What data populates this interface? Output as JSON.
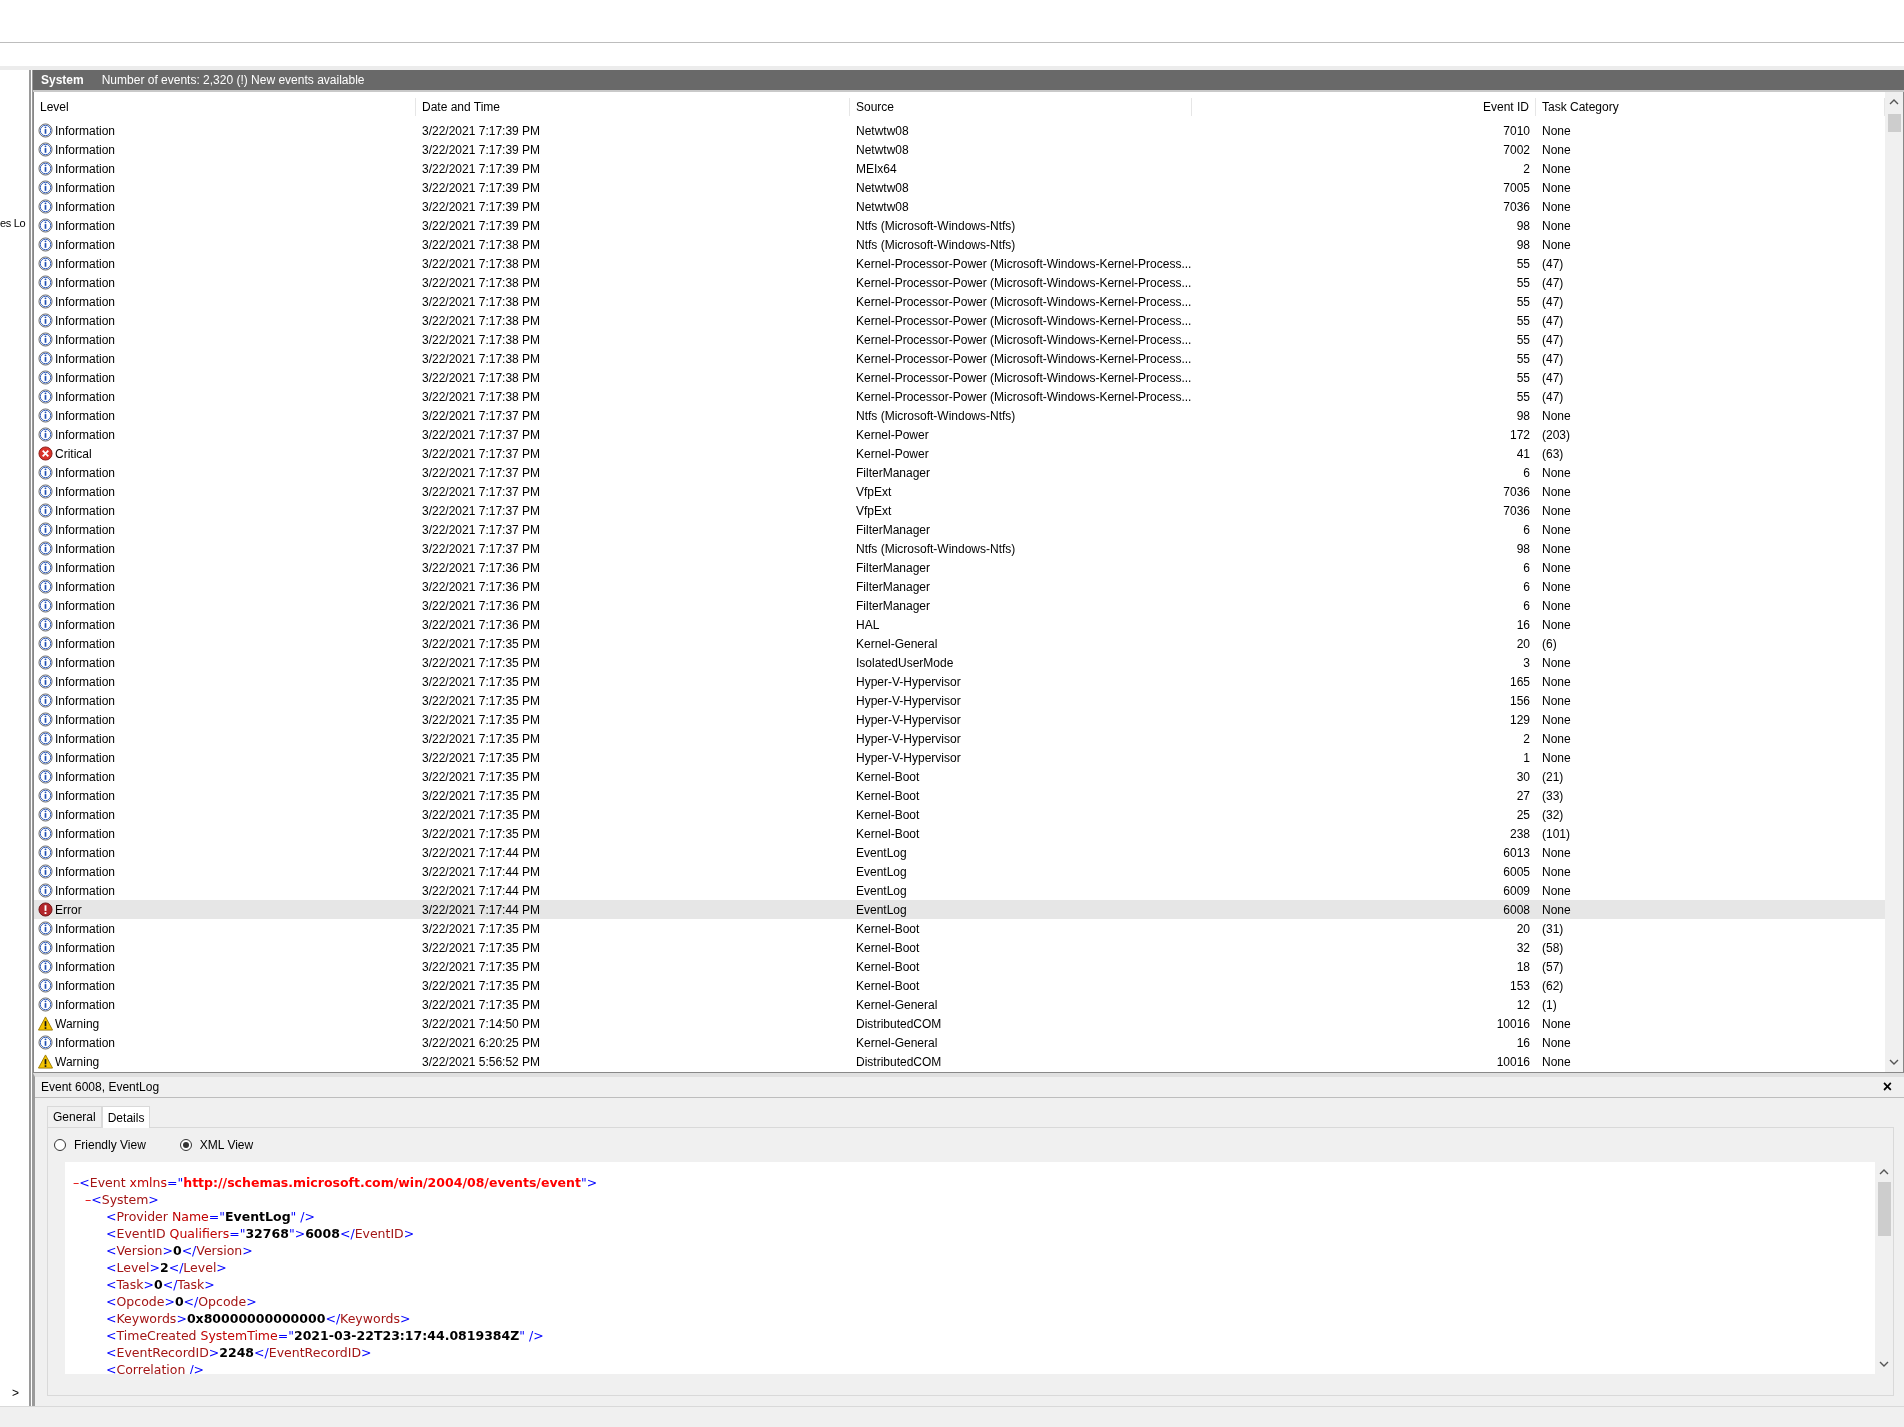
{
  "left_panel": {
    "cut_label": "es Lo",
    "expand_glyph": ">"
  },
  "log_header": {
    "title": "System",
    "summary": "Number of events: 2,320 (!) New events available"
  },
  "table": {
    "columns": [
      {
        "label": "Level"
      },
      {
        "label": "Date and Time"
      },
      {
        "label": "Source"
      },
      {
        "label": "Event ID"
      },
      {
        "label": "Task Category"
      }
    ],
    "rows": [
      {
        "kind": "information",
        "level": "Information",
        "date": "3/22/2021 7:17:39 PM",
        "source": "Netwtw08",
        "event_id": "7010",
        "task_category": "None",
        "selected": false
      },
      {
        "kind": "information",
        "level": "Information",
        "date": "3/22/2021 7:17:39 PM",
        "source": "Netwtw08",
        "event_id": "7002",
        "task_category": "None",
        "selected": false
      },
      {
        "kind": "information",
        "level": "Information",
        "date": "3/22/2021 7:17:39 PM",
        "source": "MEIx64",
        "event_id": "2",
        "task_category": "None",
        "selected": false
      },
      {
        "kind": "information",
        "level": "Information",
        "date": "3/22/2021 7:17:39 PM",
        "source": "Netwtw08",
        "event_id": "7005",
        "task_category": "None",
        "selected": false
      },
      {
        "kind": "information",
        "level": "Information",
        "date": "3/22/2021 7:17:39 PM",
        "source": "Netwtw08",
        "event_id": "7036",
        "task_category": "None",
        "selected": false
      },
      {
        "kind": "information",
        "level": "Information",
        "date": "3/22/2021 7:17:39 PM",
        "source": "Ntfs (Microsoft-Windows-Ntfs)",
        "event_id": "98",
        "task_category": "None",
        "selected": false
      },
      {
        "kind": "information",
        "level": "Information",
        "date": "3/22/2021 7:17:38 PM",
        "source": "Ntfs (Microsoft-Windows-Ntfs)",
        "event_id": "98",
        "task_category": "None",
        "selected": false
      },
      {
        "kind": "information",
        "level": "Information",
        "date": "3/22/2021 7:17:38 PM",
        "source": "Kernel-Processor-Power (Microsoft-Windows-Kernel-Process...",
        "event_id": "55",
        "task_category": "(47)",
        "selected": false
      },
      {
        "kind": "information",
        "level": "Information",
        "date": "3/22/2021 7:17:38 PM",
        "source": "Kernel-Processor-Power (Microsoft-Windows-Kernel-Process...",
        "event_id": "55",
        "task_category": "(47)",
        "selected": false
      },
      {
        "kind": "information",
        "level": "Information",
        "date": "3/22/2021 7:17:38 PM",
        "source": "Kernel-Processor-Power (Microsoft-Windows-Kernel-Process...",
        "event_id": "55",
        "task_category": "(47)",
        "selected": false
      },
      {
        "kind": "information",
        "level": "Information",
        "date": "3/22/2021 7:17:38 PM",
        "source": "Kernel-Processor-Power (Microsoft-Windows-Kernel-Process...",
        "event_id": "55",
        "task_category": "(47)",
        "selected": false
      },
      {
        "kind": "information",
        "level": "Information",
        "date": "3/22/2021 7:17:38 PM",
        "source": "Kernel-Processor-Power (Microsoft-Windows-Kernel-Process...",
        "event_id": "55",
        "task_category": "(47)",
        "selected": false
      },
      {
        "kind": "information",
        "level": "Information",
        "date": "3/22/2021 7:17:38 PM",
        "source": "Kernel-Processor-Power (Microsoft-Windows-Kernel-Process...",
        "event_id": "55",
        "task_category": "(47)",
        "selected": false
      },
      {
        "kind": "information",
        "level": "Information",
        "date": "3/22/2021 7:17:38 PM",
        "source": "Kernel-Processor-Power (Microsoft-Windows-Kernel-Process...",
        "event_id": "55",
        "task_category": "(47)",
        "selected": false
      },
      {
        "kind": "information",
        "level": "Information",
        "date": "3/22/2021 7:17:38 PM",
        "source": "Kernel-Processor-Power (Microsoft-Windows-Kernel-Process...",
        "event_id": "55",
        "task_category": "(47)",
        "selected": false
      },
      {
        "kind": "information",
        "level": "Information",
        "date": "3/22/2021 7:17:37 PM",
        "source": "Ntfs (Microsoft-Windows-Ntfs)",
        "event_id": "98",
        "task_category": "None",
        "selected": false
      },
      {
        "kind": "information",
        "level": "Information",
        "date": "3/22/2021 7:17:37 PM",
        "source": "Kernel-Power",
        "event_id": "172",
        "task_category": "(203)",
        "selected": false
      },
      {
        "kind": "critical",
        "level": "Critical",
        "date": "3/22/2021 7:17:37 PM",
        "source": "Kernel-Power",
        "event_id": "41",
        "task_category": "(63)",
        "selected": false
      },
      {
        "kind": "information",
        "level": "Information",
        "date": "3/22/2021 7:17:37 PM",
        "source": "FilterManager",
        "event_id": "6",
        "task_category": "None",
        "selected": false
      },
      {
        "kind": "information",
        "level": "Information",
        "date": "3/22/2021 7:17:37 PM",
        "source": "VfpExt",
        "event_id": "7036",
        "task_category": "None",
        "selected": false
      },
      {
        "kind": "information",
        "level": "Information",
        "date": "3/22/2021 7:17:37 PM",
        "source": "VfpExt",
        "event_id": "7036",
        "task_category": "None",
        "selected": false
      },
      {
        "kind": "information",
        "level": "Information",
        "date": "3/22/2021 7:17:37 PM",
        "source": "FilterManager",
        "event_id": "6",
        "task_category": "None",
        "selected": false
      },
      {
        "kind": "information",
        "level": "Information",
        "date": "3/22/2021 7:17:37 PM",
        "source": "Ntfs (Microsoft-Windows-Ntfs)",
        "event_id": "98",
        "task_category": "None",
        "selected": false
      },
      {
        "kind": "information",
        "level": "Information",
        "date": "3/22/2021 7:17:36 PM",
        "source": "FilterManager",
        "event_id": "6",
        "task_category": "None",
        "selected": false
      },
      {
        "kind": "information",
        "level": "Information",
        "date": "3/22/2021 7:17:36 PM",
        "source": "FilterManager",
        "event_id": "6",
        "task_category": "None",
        "selected": false
      },
      {
        "kind": "information",
        "level": "Information",
        "date": "3/22/2021 7:17:36 PM",
        "source": "FilterManager",
        "event_id": "6",
        "task_category": "None",
        "selected": false
      },
      {
        "kind": "information",
        "level": "Information",
        "date": "3/22/2021 7:17:36 PM",
        "source": "HAL",
        "event_id": "16",
        "task_category": "None",
        "selected": false
      },
      {
        "kind": "information",
        "level": "Information",
        "date": "3/22/2021 7:17:35 PM",
        "source": "Kernel-General",
        "event_id": "20",
        "task_category": "(6)",
        "selected": false
      },
      {
        "kind": "information",
        "level": "Information",
        "date": "3/22/2021 7:17:35 PM",
        "source": "IsolatedUserMode",
        "event_id": "3",
        "task_category": "None",
        "selected": false
      },
      {
        "kind": "information",
        "level": "Information",
        "date": "3/22/2021 7:17:35 PM",
        "source": "Hyper-V-Hypervisor",
        "event_id": "165",
        "task_category": "None",
        "selected": false
      },
      {
        "kind": "information",
        "level": "Information",
        "date": "3/22/2021 7:17:35 PM",
        "source": "Hyper-V-Hypervisor",
        "event_id": "156",
        "task_category": "None",
        "selected": false
      },
      {
        "kind": "information",
        "level": "Information",
        "date": "3/22/2021 7:17:35 PM",
        "source": "Hyper-V-Hypervisor",
        "event_id": "129",
        "task_category": "None",
        "selected": false
      },
      {
        "kind": "information",
        "level": "Information",
        "date": "3/22/2021 7:17:35 PM",
        "source": "Hyper-V-Hypervisor",
        "event_id": "2",
        "task_category": "None",
        "selected": false
      },
      {
        "kind": "information",
        "level": "Information",
        "date": "3/22/2021 7:17:35 PM",
        "source": "Hyper-V-Hypervisor",
        "event_id": "1",
        "task_category": "None",
        "selected": false
      },
      {
        "kind": "information",
        "level": "Information",
        "date": "3/22/2021 7:17:35 PM",
        "source": "Kernel-Boot",
        "event_id": "30",
        "task_category": "(21)",
        "selected": false
      },
      {
        "kind": "information",
        "level": "Information",
        "date": "3/22/2021 7:17:35 PM",
        "source": "Kernel-Boot",
        "event_id": "27",
        "task_category": "(33)",
        "selected": false
      },
      {
        "kind": "information",
        "level": "Information",
        "date": "3/22/2021 7:17:35 PM",
        "source": "Kernel-Boot",
        "event_id": "25",
        "task_category": "(32)",
        "selected": false
      },
      {
        "kind": "information",
        "level": "Information",
        "date": "3/22/2021 7:17:35 PM",
        "source": "Kernel-Boot",
        "event_id": "238",
        "task_category": "(101)",
        "selected": false
      },
      {
        "kind": "information",
        "level": "Information",
        "date": "3/22/2021 7:17:44 PM",
        "source": "EventLog",
        "event_id": "6013",
        "task_category": "None",
        "selected": false
      },
      {
        "kind": "information",
        "level": "Information",
        "date": "3/22/2021 7:17:44 PM",
        "source": "EventLog",
        "event_id": "6005",
        "task_category": "None",
        "selected": false
      },
      {
        "kind": "information",
        "level": "Information",
        "date": "3/22/2021 7:17:44 PM",
        "source": "EventLog",
        "event_id": "6009",
        "task_category": "None",
        "selected": false
      },
      {
        "kind": "error",
        "level": "Error",
        "date": "3/22/2021 7:17:44 PM",
        "source": "EventLog",
        "event_id": "6008",
        "task_category": "None",
        "selected": true
      },
      {
        "kind": "information",
        "level": "Information",
        "date": "3/22/2021 7:17:35 PM",
        "source": "Kernel-Boot",
        "event_id": "20",
        "task_category": "(31)",
        "selected": false
      },
      {
        "kind": "information",
        "level": "Information",
        "date": "3/22/2021 7:17:35 PM",
        "source": "Kernel-Boot",
        "event_id": "32",
        "task_category": "(58)",
        "selected": false
      },
      {
        "kind": "information",
        "level": "Information",
        "date": "3/22/2021 7:17:35 PM",
        "source": "Kernel-Boot",
        "event_id": "18",
        "task_category": "(57)",
        "selected": false
      },
      {
        "kind": "information",
        "level": "Information",
        "date": "3/22/2021 7:17:35 PM",
        "source": "Kernel-Boot",
        "event_id": "153",
        "task_category": "(62)",
        "selected": false
      },
      {
        "kind": "information",
        "level": "Information",
        "date": "3/22/2021 7:17:35 PM",
        "source": "Kernel-General",
        "event_id": "12",
        "task_category": "(1)",
        "selected": false
      },
      {
        "kind": "warning",
        "level": "Warning",
        "date": "3/22/2021 7:14:50 PM",
        "source": "DistributedCOM",
        "event_id": "10016",
        "task_category": "None",
        "selected": false
      },
      {
        "kind": "information",
        "level": "Information",
        "date": "3/22/2021 6:20:25 PM",
        "source": "Kernel-General",
        "event_id": "16",
        "task_category": "None",
        "selected": false
      },
      {
        "kind": "warning",
        "level": "Warning",
        "date": "3/22/2021 5:56:52 PM",
        "source": "DistributedCOM",
        "event_id": "10016",
        "task_category": "None",
        "selected": false
      }
    ]
  },
  "details": {
    "title": "Event 6008, EventLog",
    "close": "×",
    "tabs": [
      {
        "label": "General",
        "selected": false
      },
      {
        "label": "Details",
        "selected": true
      }
    ],
    "views": [
      {
        "label": "Friendly View",
        "selected": false
      },
      {
        "label": "XML View",
        "selected": true
      }
    ],
    "xml": [
      {
        "toggle": "–",
        "parts": [
          {
            "kind": "punct",
            "text": "<"
          },
          {
            "kind": "tag",
            "text": "Event"
          },
          {
            "kind": "attr",
            "text": " xmlns"
          },
          {
            "kind": "punct",
            "text": "=\""
          },
          {
            "kind": "nsvalue",
            "text": "http://schemas.microsoft.com/win/2004/08/events/event"
          },
          {
            "kind": "punct",
            "text": "\">"
          }
        ],
        "children": [
          {
            "toggle": "–",
            "parts": [
              {
                "kind": "punct",
                "text": "<"
              },
              {
                "kind": "tag",
                "text": "System"
              },
              {
                "kind": "punct",
                "text": ">"
              }
            ],
            "children": [
              {
                "parts": [
                  {
                    "kind": "punct",
                    "text": "<"
                  },
                  {
                    "kind": "tag",
                    "text": "Provider"
                  },
                  {
                    "kind": "attr",
                    "text": " Name"
                  },
                  {
                    "kind": "punct",
                    "text": "=\""
                  },
                  {
                    "kind": "value",
                    "text": "EventLog"
                  },
                  {
                    "kind": "punct",
                    "text": "\" />"
                  }
                ]
              },
              {
                "parts": [
                  {
                    "kind": "punct",
                    "text": "<"
                  },
                  {
                    "kind": "tag",
                    "text": "EventID"
                  },
                  {
                    "kind": "attr",
                    "text": " Qualifiers"
                  },
                  {
                    "kind": "punct",
                    "text": "=\""
                  },
                  {
                    "kind": "value",
                    "text": "32768"
                  },
                  {
                    "kind": "punct",
                    "text": "\">"
                  },
                  {
                    "kind": "value",
                    "text": "6008"
                  },
                  {
                    "kind": "punct",
                    "text": "</"
                  },
                  {
                    "kind": "tag",
                    "text": "EventID"
                  },
                  {
                    "kind": "punct",
                    "text": ">"
                  }
                ]
              },
              {
                "parts": [
                  {
                    "kind": "punct",
                    "text": "<"
                  },
                  {
                    "kind": "tag",
                    "text": "Version"
                  },
                  {
                    "kind": "punct",
                    "text": ">"
                  },
                  {
                    "kind": "value",
                    "text": "0"
                  },
                  {
                    "kind": "punct",
                    "text": "</"
                  },
                  {
                    "kind": "tag",
                    "text": "Version"
                  },
                  {
                    "kind": "punct",
                    "text": ">"
                  }
                ]
              },
              {
                "parts": [
                  {
                    "kind": "punct",
                    "text": "<"
                  },
                  {
                    "kind": "tag",
                    "text": "Level"
                  },
                  {
                    "kind": "punct",
                    "text": ">"
                  },
                  {
                    "kind": "value",
                    "text": "2"
                  },
                  {
                    "kind": "punct",
                    "text": "</"
                  },
                  {
                    "kind": "tag",
                    "text": "Level"
                  },
                  {
                    "kind": "punct",
                    "text": ">"
                  }
                ]
              },
              {
                "parts": [
                  {
                    "kind": "punct",
                    "text": "<"
                  },
                  {
                    "kind": "tag",
                    "text": "Task"
                  },
                  {
                    "kind": "punct",
                    "text": ">"
                  },
                  {
                    "kind": "value",
                    "text": "0"
                  },
                  {
                    "kind": "punct",
                    "text": "</"
                  },
                  {
                    "kind": "tag",
                    "text": "Task"
                  },
                  {
                    "kind": "punct",
                    "text": ">"
                  }
                ]
              },
              {
                "parts": [
                  {
                    "kind": "punct",
                    "text": "<"
                  },
                  {
                    "kind": "tag",
                    "text": "Opcode"
                  },
                  {
                    "kind": "punct",
                    "text": ">"
                  },
                  {
                    "kind": "value",
                    "text": "0"
                  },
                  {
                    "kind": "punct",
                    "text": "</"
                  },
                  {
                    "kind": "tag",
                    "text": "Opcode"
                  },
                  {
                    "kind": "punct",
                    "text": ">"
                  }
                ]
              },
              {
                "parts": [
                  {
                    "kind": "punct",
                    "text": "<"
                  },
                  {
                    "kind": "tag",
                    "text": "Keywords"
                  },
                  {
                    "kind": "punct",
                    "text": ">"
                  },
                  {
                    "kind": "value",
                    "text": "0x80000000000000"
                  },
                  {
                    "kind": "punct",
                    "text": "</"
                  },
                  {
                    "kind": "tag",
                    "text": "Keywords"
                  },
                  {
                    "kind": "punct",
                    "text": ">"
                  }
                ]
              },
              {
                "parts": [
                  {
                    "kind": "punct",
                    "text": "<"
                  },
                  {
                    "kind": "tag",
                    "text": "TimeCreated"
                  },
                  {
                    "kind": "attr",
                    "text": " SystemTime"
                  },
                  {
                    "kind": "punct",
                    "text": "=\""
                  },
                  {
                    "kind": "value",
                    "text": "2021-03-22T23:17:44.0819384Z"
                  },
                  {
                    "kind": "punct",
                    "text": "\" />"
                  }
                ]
              },
              {
                "parts": [
                  {
                    "kind": "punct",
                    "text": "<"
                  },
                  {
                    "kind": "tag",
                    "text": "EventRecordID"
                  },
                  {
                    "kind": "punct",
                    "text": ">"
                  },
                  {
                    "kind": "value",
                    "text": "2248"
                  },
                  {
                    "kind": "punct",
                    "text": "</"
                  },
                  {
                    "kind": "tag",
                    "text": "EventRecordID"
                  },
                  {
                    "kind": "punct",
                    "text": ">"
                  }
                ]
              },
              {
                "parts": [
                  {
                    "kind": "punct",
                    "text": "<"
                  },
                  {
                    "kind": "tag",
                    "text": "Correlation"
                  },
                  {
                    "kind": "punct",
                    "text": " />"
                  }
                ]
              }
            ]
          }
        ]
      }
    ]
  }
}
